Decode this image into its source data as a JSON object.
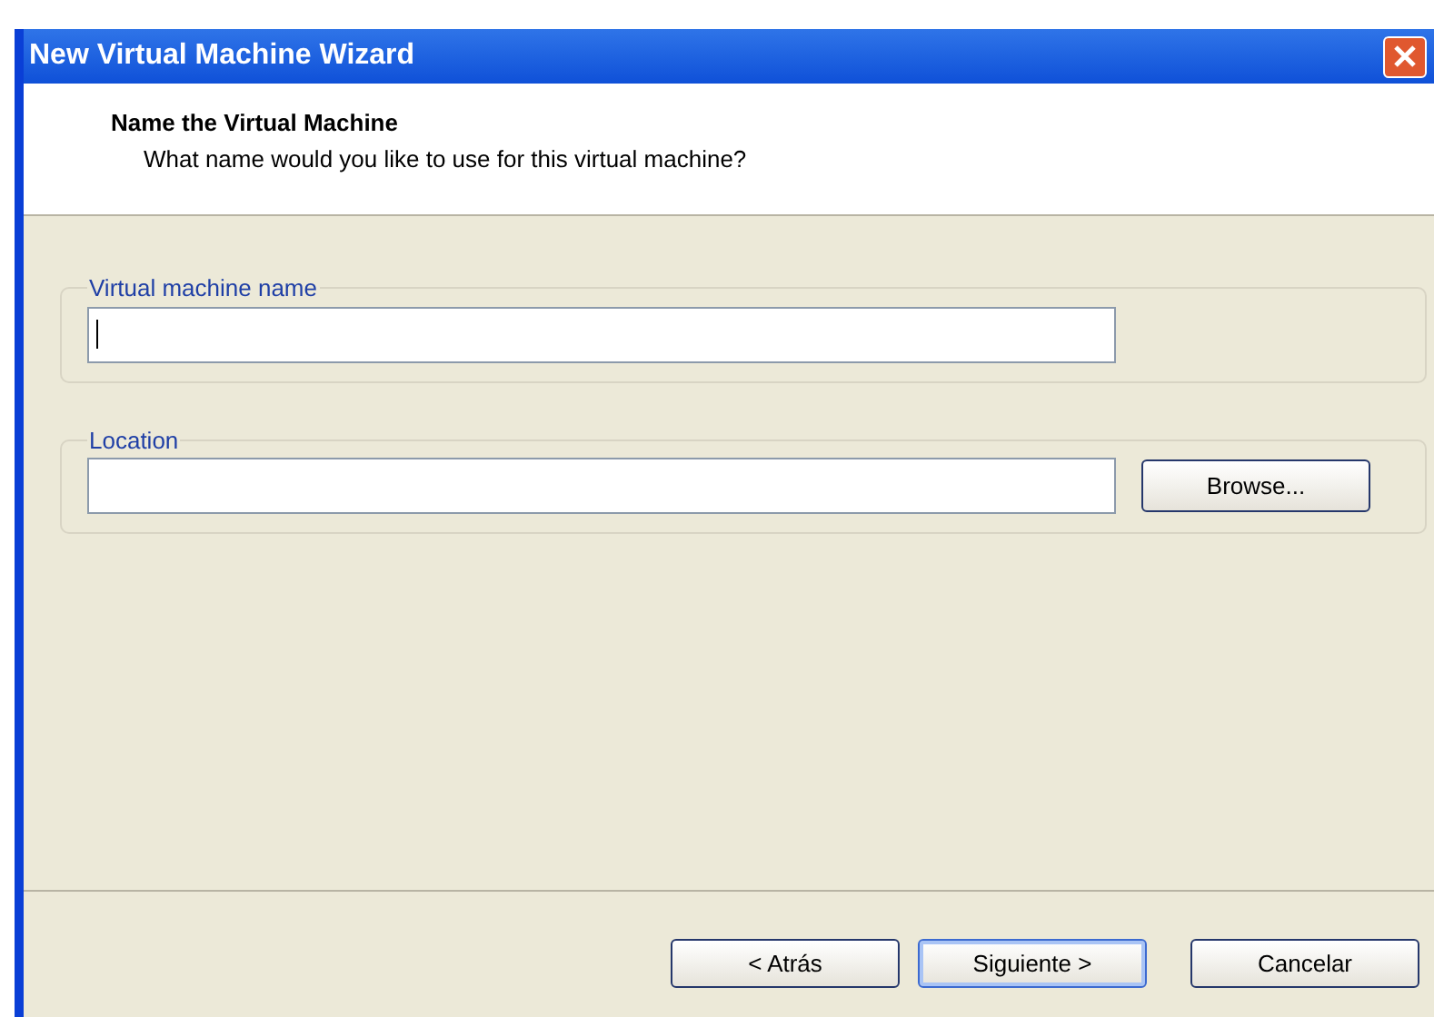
{
  "window": {
    "title": "New Virtual Machine Wizard"
  },
  "header": {
    "title": "Name the Virtual Machine",
    "subtitle": "What name would you like to use for this virtual machine?"
  },
  "groups": [
    {
      "label": "Virtual machine name",
      "field": {
        "focused": true
      }
    },
    {
      "label": "Location",
      "field": {
        "focused": false
      },
      "button": "Browse..."
    }
  ],
  "buttons": [
    {
      "label": "< Atrás",
      "default": false
    },
    {
      "label": "Siguiente >",
      "default": true
    },
    {
      "label": "Cancelar",
      "default": false
    }
  ]
}
